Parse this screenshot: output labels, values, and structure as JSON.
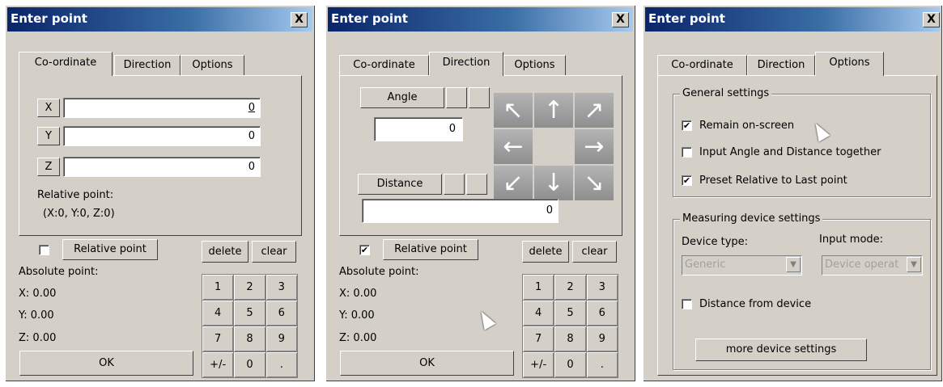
{
  "dialogs": [
    {
      "title": "Enter point",
      "close": "X",
      "tabs": [
        "Co-ordinate",
        "Direction",
        "Options"
      ],
      "coord": {
        "x_label": "X",
        "x_value": "0",
        "y_label": "Y",
        "y_value": "0",
        "z_label": "Z",
        "z_value": "0",
        "relative_heading": "Relative point:",
        "relative_value": "(X:0, Y:0, Z:0)"
      },
      "relative_checkbox": "Relative point",
      "delete": "delete",
      "clear": "clear",
      "absolute_heading": "Absolute point:",
      "abs_x": "X: 0.00",
      "abs_y": "Y: 0.00",
      "abs_z": "Z: 0.00",
      "ok": "OK",
      "keys": [
        "1",
        "2",
        "3",
        "4",
        "5",
        "6",
        "7",
        "8",
        "9",
        "+/-",
        "0",
        "."
      ]
    },
    {
      "title": "Enter point",
      "close": "X",
      "tabs": [
        "Co-ordinate",
        "Direction",
        "Options"
      ],
      "direction": {
        "angle_label": "Angle",
        "angle_value": "0",
        "distance_label": "Distance",
        "distance_value": "0",
        "arrows": [
          "↖",
          "↑",
          "↗",
          "←",
          "→",
          "↙",
          "↓",
          "↘"
        ]
      },
      "relative_checkbox": "Relative point",
      "relative_checked": "✔",
      "delete": "delete",
      "clear": "clear",
      "absolute_heading": "Absolute point:",
      "abs_x": "X: 0.00",
      "abs_y": "Y: 0.00",
      "abs_z": "Z: 0.00",
      "ok": "OK",
      "keys": [
        "1",
        "2",
        "3",
        "4",
        "5",
        "6",
        "7",
        "8",
        "9",
        "+/-",
        "0",
        "."
      ]
    },
    {
      "title": "Enter point",
      "close": "X",
      "tabs": [
        "Co-ordinate",
        "Direction",
        "Options"
      ],
      "options": {
        "general_heading": "General settings",
        "remain_onscreen": "Remain on-screen",
        "remain_checked": "✔",
        "input_together": "Input Angle and Distance together",
        "preset_relative": "Preset Relative to Last point",
        "preset_checked": "✔",
        "measuring_heading": "Measuring device settings",
        "device_type_label": "Device type:",
        "input_mode_label": "Input mode:",
        "device_type_value": "Generic",
        "input_mode_value": "Device operat",
        "distance_from_device": "Distance from device",
        "more_settings": "more device settings"
      }
    }
  ]
}
